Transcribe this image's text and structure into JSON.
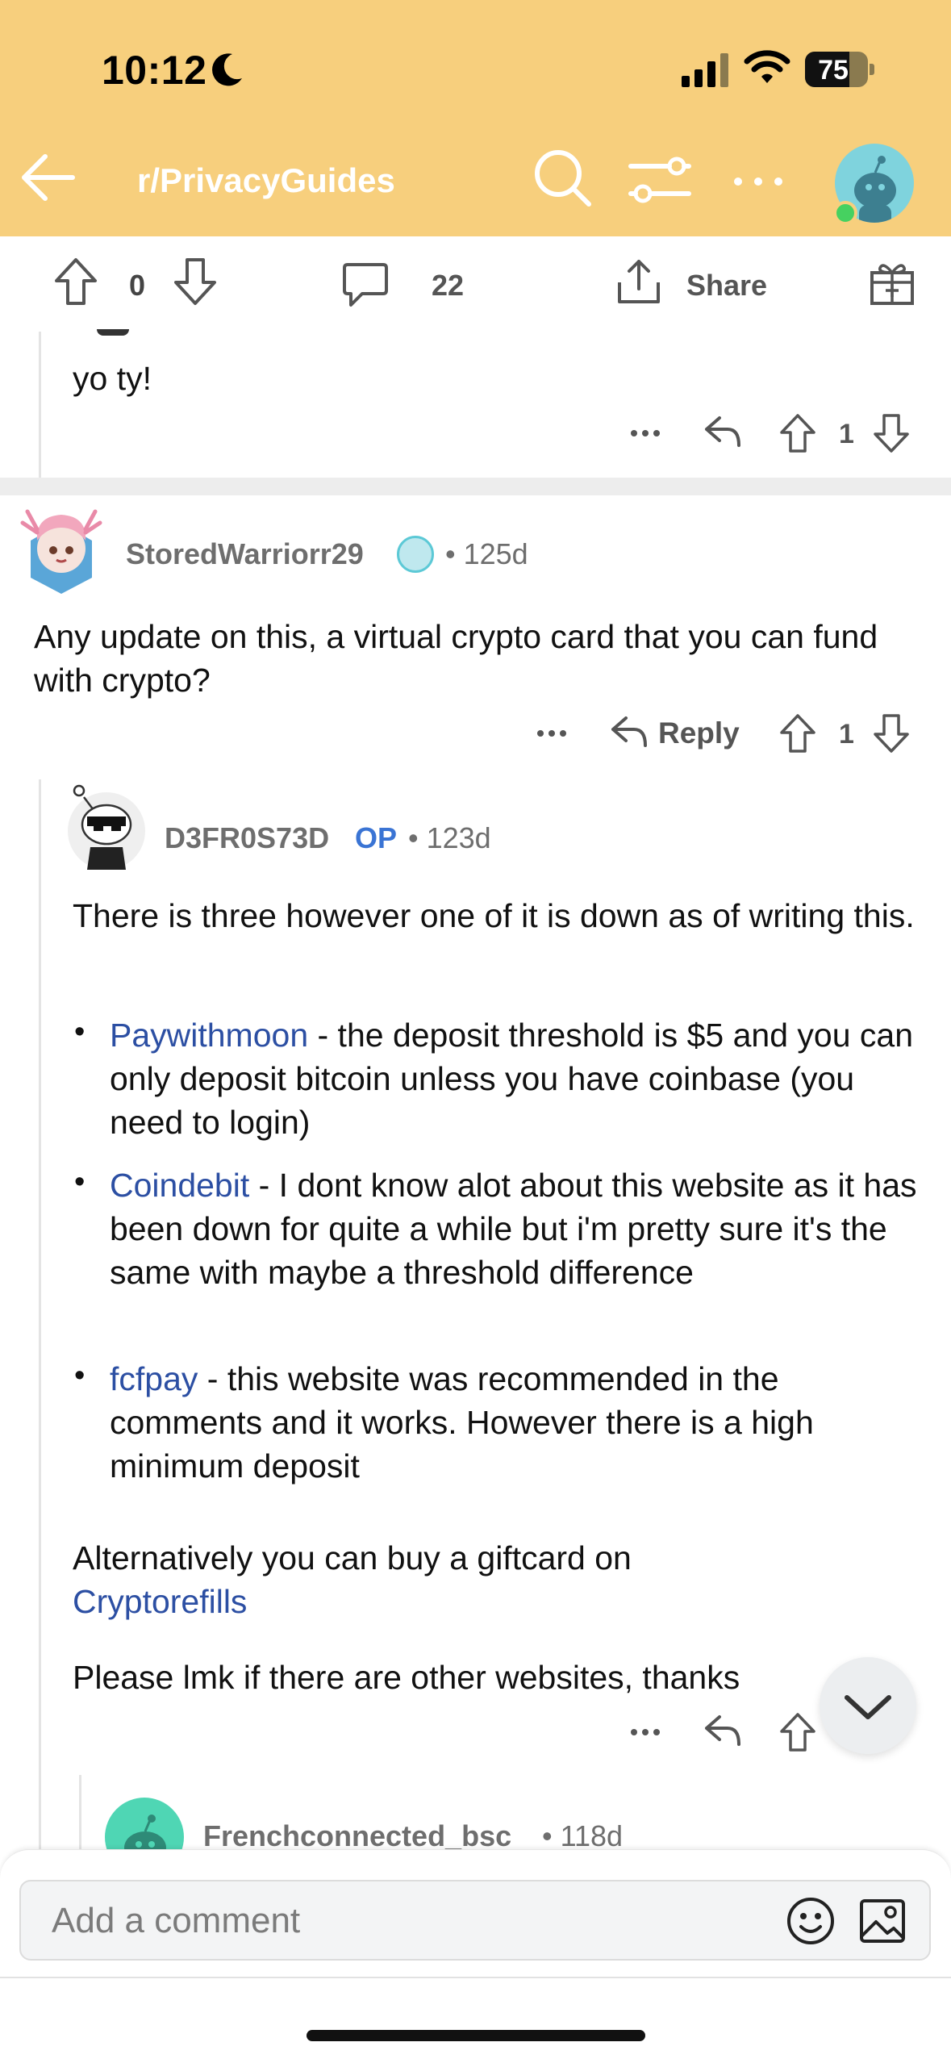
{
  "status_bar": {
    "time": "10:12",
    "battery": "75"
  },
  "header": {
    "subreddit": "r/PrivacyGuides",
    "bg_color": "#f7cf7d"
  },
  "post_actions": {
    "score": "0",
    "comments": "22",
    "share_label": "Share"
  },
  "comments": [
    {
      "text": "yo ty!",
      "score": "1"
    },
    {
      "username": "StoredWarriorr29",
      "age": "125d",
      "text": "Any update on this, a virtual crypto card that you can fund with crypto?",
      "reply_label": "Reply",
      "score": "1"
    },
    {
      "username": "D3FR0S73D",
      "op_badge": "OP",
      "age": "123d",
      "intro": "There is three however one of it is down as of writing this.",
      "items": [
        {
          "link": "Paywithmoon",
          "text": " - the deposit threshold is $5 and you can only deposit bitcoin unless you have coinbase (you need to login)"
        },
        {
          "link": "Coindebit",
          "text": " - I dont know alot about this website as it has been down for quite a while but i'm pretty sure it's the same with maybe a threshold difference"
        },
        {
          "link": "fcfpay",
          "text": " - this website was recommended in the comments and it works. However there is a high minimum deposit"
        }
      ],
      "alt_text": "Alternatively you can buy a giftcard on",
      "alt_link": "Cryptorefills",
      "closing": "Please lmk if there are other websites, thanks"
    },
    {
      "username": "Frenchconnected_bsc",
      "age": "118d"
    }
  ],
  "composer": {
    "placeholder": "Add a comment"
  }
}
